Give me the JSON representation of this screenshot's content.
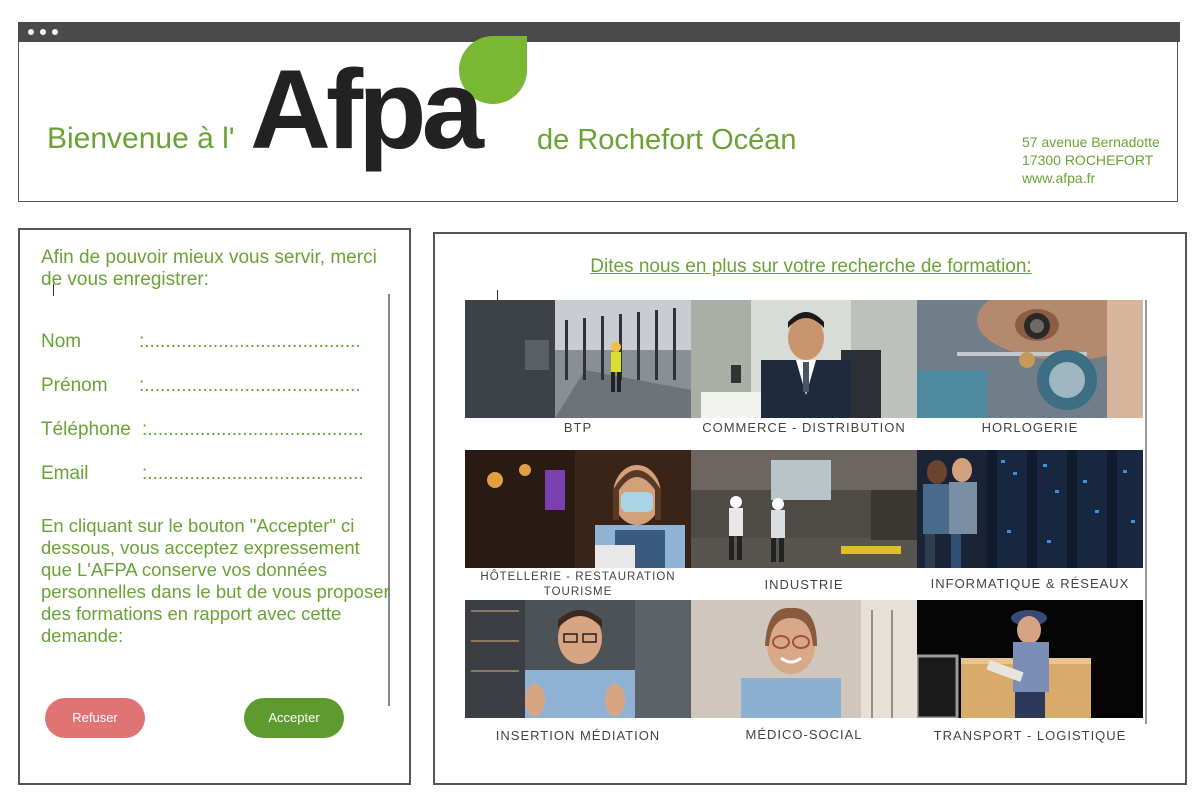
{
  "header": {
    "welcome": "Bienvenue à l'",
    "logo_text": "Afpa",
    "location": "de Rochefort Océan",
    "address": [
      "57 avenue Bernadotte",
      "17300 ROCHEFORT",
      "www.afpa.fr"
    ]
  },
  "form": {
    "intro": "Afin de pouvoir mieux vous servir, merci de vous enregistrer:",
    "fields": [
      {
        "label": "Nom",
        "dots": ":........................................."
      },
      {
        "label": "Prénom",
        "dots": ":........................................."
      },
      {
        "label": "Téléphone",
        "dots": ":........................................."
      },
      {
        "label": "Email",
        "dots": ":........................................."
      }
    ],
    "consent": "En cliquant sur le bouton \"Accepter\" ci dessous, vous acceptez expressement que L'AFPA conserve vos données personnelles dans le but de vous proposer des formations en rapport avec cette demande:",
    "refuse_label": "Refuser",
    "accept_label": "Accepter"
  },
  "catalog": {
    "title": "Dites nous en plus sur votre recherche de formation: ",
    "tiles": [
      {
        "caption": "BTP",
        "icon": "construction-photo"
      },
      {
        "caption": "COMMERCE - DISTRIBUTION",
        "icon": "business-photo"
      },
      {
        "caption": "HORLOGERIE",
        "icon": "watchmaking-photo"
      },
      {
        "caption": "HÔTELLERIE - RESTAURATION",
        "caption2": "TOURISME",
        "icon": "hospitality-photo"
      },
      {
        "caption": "INDUSTRIE",
        "icon": "industry-photo"
      },
      {
        "caption": "INFORMATIQUE & RÉSEAUX",
        "icon": "datacenter-photo"
      },
      {
        "caption": "INSERTION  MÉDIATION",
        "icon": "mediation-photo"
      },
      {
        "caption": "MÉDICO-SOCIAL",
        "icon": "medical-photo"
      },
      {
        "caption": "TRANSPORT - LOGISTIQUE",
        "icon": "logistics-photo"
      }
    ]
  },
  "colors": {
    "accent_green": "#6aa236",
    "accept_button": "#5e9a2e",
    "refuse_button": "#e07474",
    "logo_drop": "#7ab833",
    "titlebar": "#4a4a4a"
  }
}
